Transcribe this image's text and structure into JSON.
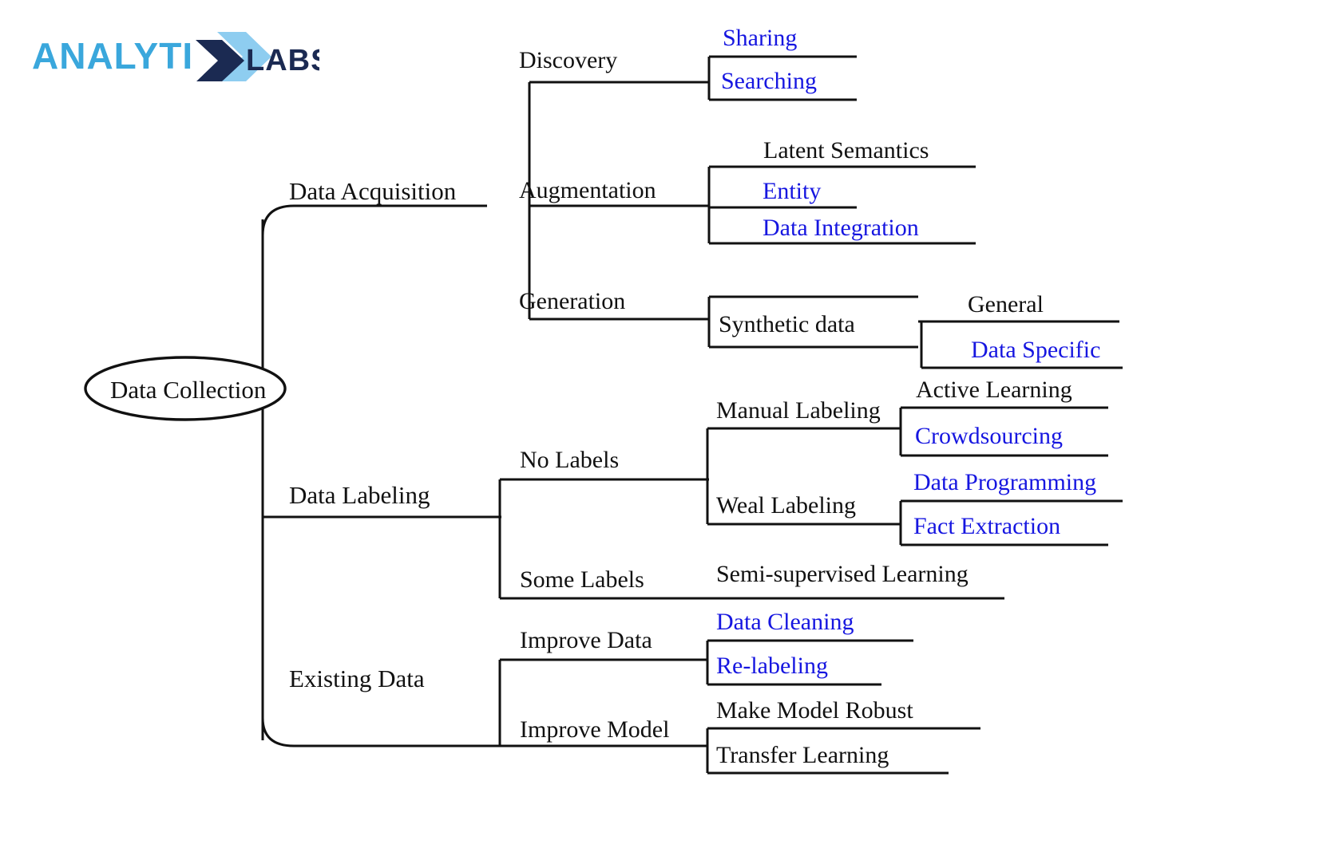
{
  "brand": {
    "name": "ANALYTIX LABS",
    "part_a": "ANALYTI",
    "part_x": "X",
    "part_b": "LABS",
    "color_light": "#3aa7dc",
    "color_dark": "#1b2a52",
    "color_x_light": "#8ecdf0"
  },
  "diagram": {
    "type": "mindmap",
    "root": "Data Collection",
    "black_hex": "#111111",
    "blue_hex": "#1616e0",
    "branches": [
      {
        "label": "Data Acquisition",
        "children": [
          {
            "label": "Discovery",
            "color": "black",
            "children": [
              {
                "label": "Sharing",
                "color": "blue"
              },
              {
                "label": "Searching",
                "color": "blue"
              }
            ]
          },
          {
            "label": "Augmentation",
            "color": "black",
            "children": [
              {
                "label": "Latent Semantics",
                "color": "black"
              },
              {
                "label": "Entity",
                "color": "blue"
              },
              {
                "label": "Data Integration",
                "color": "blue"
              }
            ]
          },
          {
            "label": "Generation",
            "color": "black",
            "children": [
              {
                "label": "Synthetic data",
                "color": "black",
                "children": [
                  {
                    "label": "General",
                    "color": "black"
                  },
                  {
                    "label": "Data Specific",
                    "color": "blue"
                  }
                ]
              }
            ]
          }
        ]
      },
      {
        "label": "Data Labeling",
        "children": [
          {
            "label": "No Labels",
            "color": "black",
            "children": [
              {
                "label": "Manual Labeling",
                "color": "black",
                "children": [
                  {
                    "label": "Active Learning",
                    "color": "black"
                  },
                  {
                    "label": "Crowdsourcing",
                    "color": "blue"
                  }
                ]
              },
              {
                "label": "Weal Labeling",
                "color": "black",
                "children": [
                  {
                    "label": "Data Programming",
                    "color": "blue"
                  },
                  {
                    "label": "Fact Extraction",
                    "color": "blue"
                  }
                ]
              }
            ]
          },
          {
            "label": "Some Labels",
            "color": "black",
            "children": [
              {
                "label": "Semi-supervised Learning",
                "color": "black"
              }
            ]
          }
        ]
      },
      {
        "label": "Existing Data",
        "children": [
          {
            "label": "Improve Data",
            "color": "black",
            "children": [
              {
                "label": "Data Cleaning",
                "color": "blue"
              },
              {
                "label": "Re-labeling",
                "color": "blue"
              }
            ]
          },
          {
            "label": "Improve Model",
            "color": "black",
            "children": [
              {
                "label": "Make Model Robust",
                "color": "black"
              },
              {
                "label": "Transfer Learning",
                "color": "black"
              }
            ]
          }
        ]
      }
    ]
  },
  "labels": {
    "root": "Data Collection",
    "data_acquisition": "Data Acquisition",
    "discovery": "Discovery",
    "sharing": "Sharing",
    "searching": "Searching",
    "augmentation": "Augmentation",
    "latent_semantics": "Latent Semantics",
    "entity": "Entity",
    "data_integration": "Data Integration",
    "generation": "Generation",
    "synthetic_data": "Synthetic data",
    "general": "General",
    "data_specific": "Data Specific",
    "data_labeling": "Data Labeling",
    "no_labels": "No Labels",
    "manual_labeling": "Manual Labeling",
    "active_learning": "Active Learning",
    "crowdsourcing": "Crowdsourcing",
    "weal_labeling": "Weal Labeling",
    "data_programming": "Data Programming",
    "fact_extraction": "Fact Extraction",
    "some_labels": "Some Labels",
    "semi_supervised": "Semi-supervised Learning",
    "existing_data": "Existing Data",
    "improve_data": "Improve Data",
    "data_cleaning": "Data Cleaning",
    "re_labeling": "Re-labeling",
    "improve_model": "Improve Model",
    "make_model_robust": "Make Model Robust",
    "transfer_learning": "Transfer Learning"
  }
}
